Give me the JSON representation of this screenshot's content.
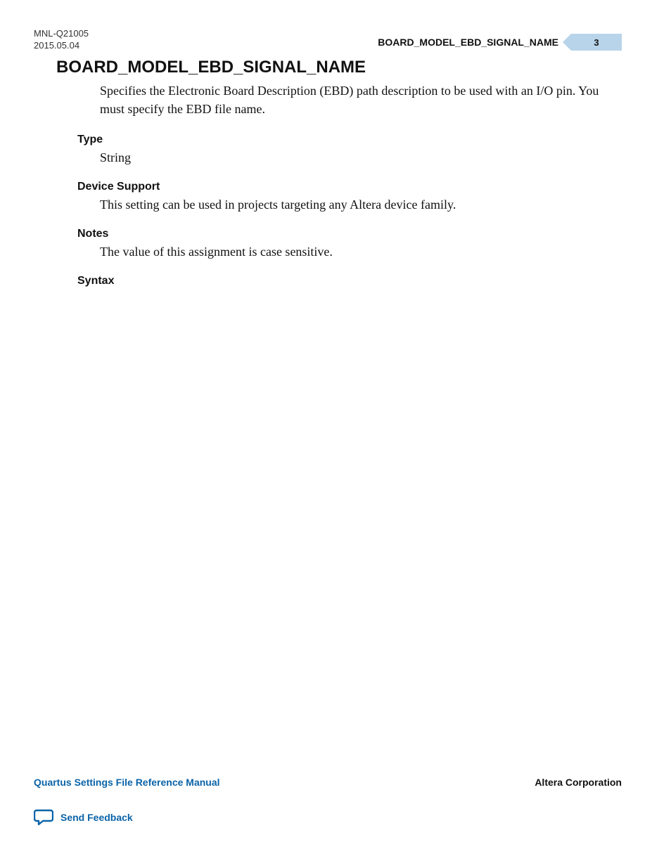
{
  "header": {
    "doc_id": "MNL-Q21005",
    "doc_date": "2015.05.04",
    "running_title": "BOARD_MODEL_EBD_SIGNAL_NAME",
    "page_number": "3"
  },
  "main": {
    "title": "BOARD_MODEL_EBD_SIGNAL_NAME",
    "description": "Specifies the Electronic Board Description (EBD) path description to be used with an I/O pin. You must specify the EBD file name.",
    "sections": [
      {
        "heading": "Type",
        "body": "String"
      },
      {
        "heading": "Device Support",
        "body": "This setting can be used in projects targeting any Altera device family."
      },
      {
        "heading": "Notes",
        "body": "The value of this assignment is case sensitive."
      },
      {
        "heading": "Syntax",
        "body": ""
      }
    ]
  },
  "footer": {
    "manual_title": "Quartus Settings File Reference Manual",
    "company": "Altera Corporation",
    "feedback_label": "Send Feedback"
  }
}
